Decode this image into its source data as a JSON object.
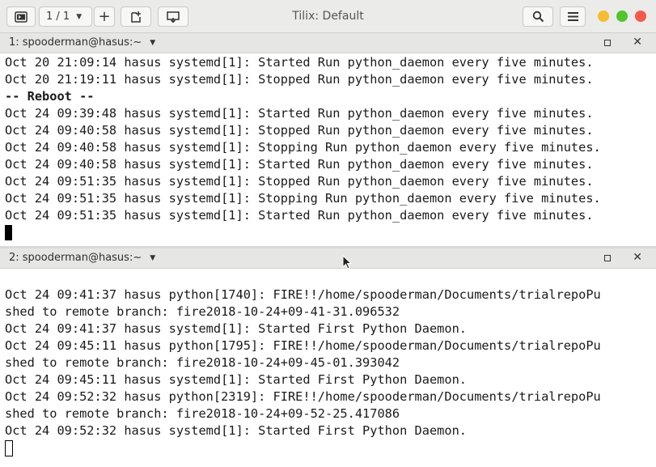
{
  "window": {
    "title": "Tilix: Default"
  },
  "toolbar": {
    "session_label": "1 / 1",
    "add_label": "+"
  },
  "colors": {
    "close": "#f35a4a",
    "minimize": "#f5bd2f",
    "maximize": "#52c52d"
  },
  "panes": [
    {
      "title": "1: spooderman@hasus:~",
      "lines": [
        "Oct 20 21:09:14 hasus systemd[1]: Started Run python_daemon every five minutes.",
        "Oct 20 21:19:11 hasus systemd[1]: Stopped Run python_daemon every five minutes.",
        "-- Reboot --",
        "Oct 24 09:39:48 hasus systemd[1]: Started Run python_daemon every five minutes.",
        "Oct 24 09:40:58 hasus systemd[1]: Stopped Run python_daemon every five minutes.",
        "Oct 24 09:40:58 hasus systemd[1]: Stopping Run python_daemon every five minutes.",
        "Oct 24 09:40:58 hasus systemd[1]: Started Run python_daemon every five minutes.",
        "Oct 24 09:51:35 hasus systemd[1]: Stopped Run python_daemon every five minutes.",
        "Oct 24 09:51:35 hasus systemd[1]: Stopping Run python_daemon every five minutes.",
        "Oct 24 09:51:35 hasus systemd[1]: Started Run python_daemon every five minutes."
      ]
    },
    {
      "title": "2: spooderman@hasus:~",
      "lines": [
        "",
        "Oct 24 09:41:37 hasus python[1740]: FIRE!!/home/spooderman/Documents/trialrepoPu",
        "shed to remote branch: fire2018-10-24+09-41-31.096532",
        "Oct 24 09:41:37 hasus systemd[1]: Started First Python Daemon.",
        "Oct 24 09:45:11 hasus python[1795]: FIRE!!/home/spooderman/Documents/trialrepoPu",
        "shed to remote branch: fire2018-10-24+09-45-01.393042",
        "Oct 24 09:45:11 hasus systemd[1]: Started First Python Daemon.",
        "Oct 24 09:52:32 hasus python[2319]: FIRE!!/home/spooderman/Documents/trialrepoPu",
        "shed to remote branch: fire2018-10-24+09-52-25.417086",
        "Oct 24 09:52:32 hasus systemd[1]: Started First Python Daemon."
      ]
    }
  ]
}
